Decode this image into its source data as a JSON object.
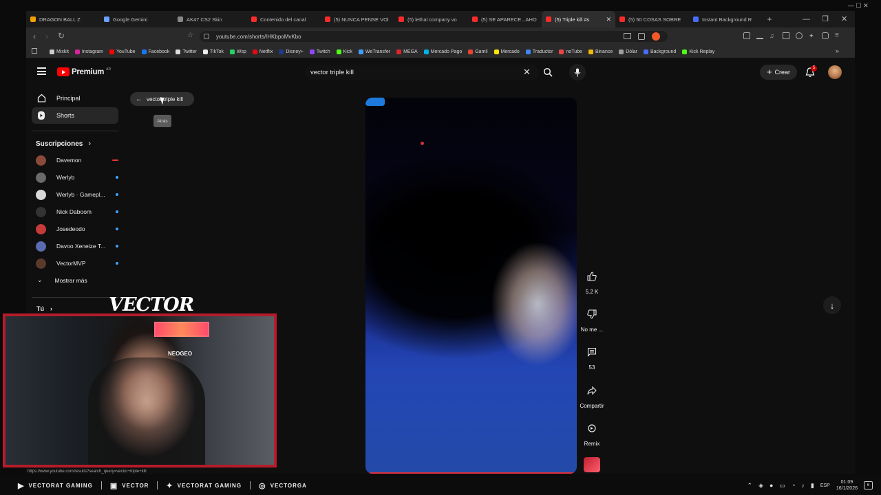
{
  "tabs": [
    {
      "title": "DRAGON BALL Z",
      "color": "#f0a000",
      "active": false
    },
    {
      "title": "Google Gemini",
      "color": "#6aa0ff",
      "active": false
    },
    {
      "title": "AK47 CS2 Skin",
      "color": "#888888",
      "active": false
    },
    {
      "title": "Contenido del canal",
      "color": "#ff2b2b",
      "active": false
    },
    {
      "title": "(5) NUNCA PENSE VOl",
      "color": "#ff2b2b",
      "active": false
    },
    {
      "title": "(5) lethal company vo",
      "color": "#ff2b2b",
      "active": false
    },
    {
      "title": "(5) SE APARECE...AHO",
      "color": "#ff2b2b",
      "active": false
    },
    {
      "title": "(5) Triple kill #s",
      "color": "#ff2b2b",
      "active": true
    },
    {
      "title": "(5) 50 COSAS SOBRE",
      "color": "#ff2b2b",
      "active": false
    },
    {
      "title": "Instant Background R",
      "color": "#4a6cff",
      "active": false
    }
  ],
  "url": "youtube.com/shorts/IHKbpoMvKbo",
  "bookmarks": [
    {
      "label": "Mixkit",
      "color": "#cccccc"
    },
    {
      "label": "Instagram",
      "color": "#d6249f"
    },
    {
      "label": "YouTube",
      "color": "#ff0000"
    },
    {
      "label": "Facebook",
      "color": "#1877f2"
    },
    {
      "label": "Twitter",
      "color": "#dddddd"
    },
    {
      "label": "TikTok",
      "color": "#eeeeee"
    },
    {
      "label": "Wsp",
      "color": "#25d366"
    },
    {
      "label": "Netflix",
      "color": "#e50914"
    },
    {
      "label": "Disney+",
      "color": "#1a3c8a"
    },
    {
      "label": "Twitch",
      "color": "#9146ff"
    },
    {
      "label": "Kick",
      "color": "#53fc18"
    },
    {
      "label": "WeTransfer",
      "color": "#409fff"
    },
    {
      "label": "MEGA",
      "color": "#d9272e"
    },
    {
      "label": "Mercado Pago",
      "color": "#00b1ea"
    },
    {
      "label": "Gamil",
      "color": "#ea4335"
    },
    {
      "label": "Mercado",
      "color": "#ffe600"
    },
    {
      "label": "Traductor",
      "color": "#4285f4"
    },
    {
      "label": "noTube",
      "color": "#e94545"
    },
    {
      "label": "Binance",
      "color": "#f0b90b"
    },
    {
      "label": "Dólar",
      "color": "#9e9e9e"
    },
    {
      "label": "Background",
      "color": "#4a6cff"
    },
    {
      "label": "Kick Replay",
      "color": "#53fc18"
    }
  ],
  "yt": {
    "logo_text": "Premium",
    "logo_sup": "AR",
    "search_value": "vector triple kill",
    "create_label": "Crear",
    "notif_count": "5",
    "back_chip": "vector triple kill",
    "back_tooltip": "Atrás",
    "nav": [
      {
        "label": "Principal"
      },
      {
        "label": "Shorts"
      }
    ],
    "subs_title": "Suscripciones",
    "subs": [
      {
        "name": "Davemon",
        "color": "#8a4a3a",
        "status": "red"
      },
      {
        "name": "Werlyb",
        "color": "#6a6a6a",
        "status": "dot"
      },
      {
        "name": "Werlyb · Gamepl...",
        "color": "#d8d8d8",
        "status": "dot"
      },
      {
        "name": "Nick Daboom",
        "color": "#333333",
        "status": "dot"
      },
      {
        "name": "Josedeodo",
        "color": "#c63a3a",
        "status": "dot"
      },
      {
        "name": "Davoo Xeneize T...",
        "color": "#5a6bb0",
        "status": "dot"
      },
      {
        "name": "VectorMVP",
        "color": "#5a3a2a",
        "status": "dot"
      }
    ],
    "show_more": "Mostrar más",
    "you_label": "Tú",
    "actions": [
      {
        "label": "5.2 K"
      },
      {
        "label": "No me ..."
      },
      {
        "label": "53"
      },
      {
        "label": "Compartir"
      },
      {
        "label": "Remix"
      }
    ],
    "status_url": "https://www.youtube.com/results?search_query=vector+triple+kill"
  },
  "overlay": {
    "name": "VECTOR",
    "arcade_label": "NEOGEO"
  },
  "taskbar": {
    "socials": [
      "VECTORAT GAMING",
      "VECTOR",
      "VECTORAT GAMING",
      "VECTORGA"
    ],
    "lang": "ESP",
    "time": "01:09",
    "date": "16/1/2026",
    "notif": "6"
  }
}
